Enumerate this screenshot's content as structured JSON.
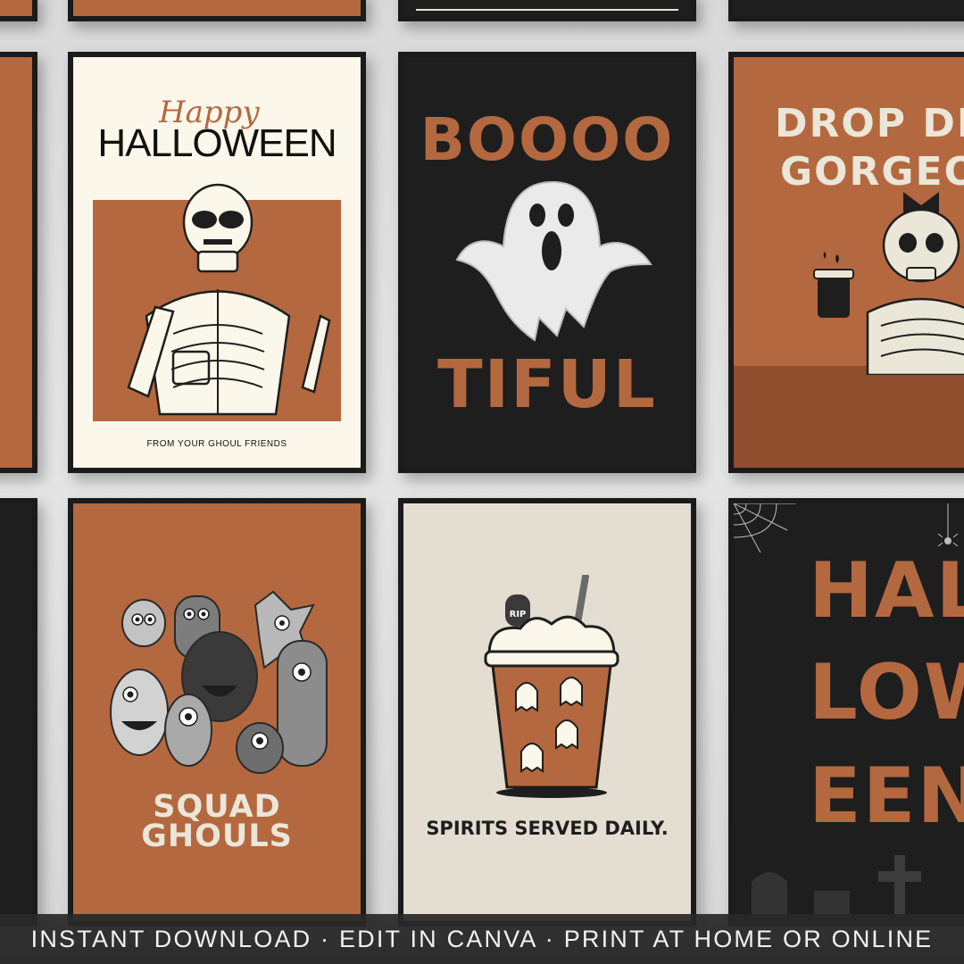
{
  "colors": {
    "orange": "#b4683f",
    "cream": "#fbf7ea",
    "black": "#1e1e1e",
    "beige": "#e4ddd1",
    "bone": "#eae6d8"
  },
  "poster_halloween_skeleton": {
    "script_text": "Happy",
    "title": "HALLOWEEN",
    "footer": "FROM YOUR GHOUL FRIENDS",
    "icon": "skeleton-coffee-icon"
  },
  "poster_boootiful": {
    "line1": "BOOOO",
    "line2": "TIFUL",
    "icon": "ghost-icon"
  },
  "poster_drop_dead": {
    "line1": "DROP DEAD",
    "line2": "GORGEOUS",
    "icon": "skeleton-bow-icon"
  },
  "poster_squad_ghouls": {
    "title": "SQUAD GHOULS",
    "icon": "monsters-group-icon"
  },
  "poster_spirits": {
    "title": "SPIRITS SERVED DAILY.",
    "rip": "RIP",
    "icon": "ghost-latte-icon"
  },
  "poster_halloween_drip": {
    "line1": "HAL",
    "line2": "LOW",
    "line3": "EEN",
    "icon": "spider-web-icon"
  },
  "banner": {
    "text": "INSTANT DOWNLOAD · EDIT IN CANVA · PRINT AT HOME OR ONLINE"
  }
}
